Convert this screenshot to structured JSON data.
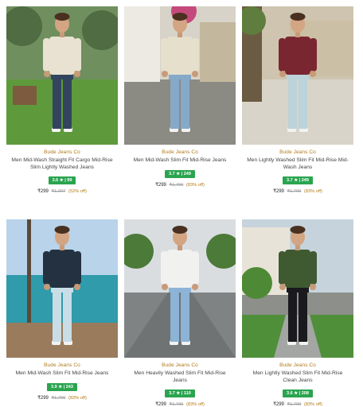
{
  "products": [
    {
      "brand": "Bude Jeans Co",
      "title": "Men Mid-Wash Straight Fit Cargo Mid-Rise Slim Lightly Washed Jeans",
      "rating": "3.6 ★ | 99",
      "price": "₹299",
      "mrp": "₹1,207",
      "discount": "(52% off)",
      "scene": "garden",
      "colors": {
        "sky": "#6f8f5e",
        "ground": "#5e9a3c",
        "shirt": "#e9e2d2",
        "pants": "#33445f",
        "accent": "#7d5b3e"
      }
    },
    {
      "brand": "Bude Jeans Co",
      "title": "Men Mid-Wash Slim Fit Mid-Rise Jeans",
      "rating": "3.7 ★ | 249",
      "price": "₹299",
      "mrp": "₹1,799",
      "discount": "(83% off)",
      "scene": "street",
      "colors": {
        "sky": "#d7d3c8",
        "ground": "#8b8a83",
        "shirt": "#e6dfcc",
        "pants": "#86a9c9",
        "accent": "#c44a7c"
      }
    },
    {
      "brand": "Bude Jeans Co",
      "title": "Men Lightly Washed Slim Fit Mid-Rise Mid-Wash Jeans",
      "rating": "3.7 ★ | 249",
      "price": "₹299",
      "mrp": "₹1,799",
      "discount": "(83% off)",
      "scene": "plaza",
      "colors": {
        "sky": "#cfc4b0",
        "ground": "#d9d4c9",
        "shirt": "#7a2630",
        "pants": "#bcd3d9",
        "accent": "#5f7d3e"
      }
    },
    {
      "brand": "Bude Jeans Co",
      "title": "Men Mid-Wash Slim Fit Mid-Rise Jeans",
      "rating": "3.9 ★ | 243",
      "price": "₹299",
      "mrp": "₹1,799",
      "discount": "(83% off)",
      "scene": "beach",
      "colors": {
        "sky": "#a7c6e0",
        "ground": "#2f9bab",
        "shirt": "#243140",
        "pants": "#c9dde6",
        "accent": "#9a7b5c"
      }
    },
    {
      "brand": "Bude Jeans Co",
      "title": "Men Heavily Washed Slim Fit Mid-Rise Jeans",
      "rating": "3.7 ★ | 110",
      "price": "₹299",
      "mrp": "₹1,799",
      "discount": "(83% off)",
      "scene": "avenue",
      "colors": {
        "sky": "#d9dde0",
        "ground": "#7f8384",
        "shirt": "#f1f1f0",
        "pants": "#8db3d6",
        "accent": "#4c7a38"
      }
    },
    {
      "brand": "Bude Jeans Co",
      "title": "Men Lightly Washed Slim Fit Mid-Rise Clean Jeans",
      "rating": "3.6 ★ | 208",
      "price": "₹299",
      "mrp": "₹1,799",
      "discount": "(83% off)",
      "scene": "villa",
      "colors": {
        "sky": "#c6d3dc",
        "ground": "#8c8f8a",
        "shirt": "#3f5a31",
        "pants": "#1a1a1e",
        "accent": "#4e8a35"
      }
    }
  ],
  "colors": {
    "brand": "#b07a17",
    "rating_bg": "#2aa44f",
    "discount": "#b07a17"
  }
}
